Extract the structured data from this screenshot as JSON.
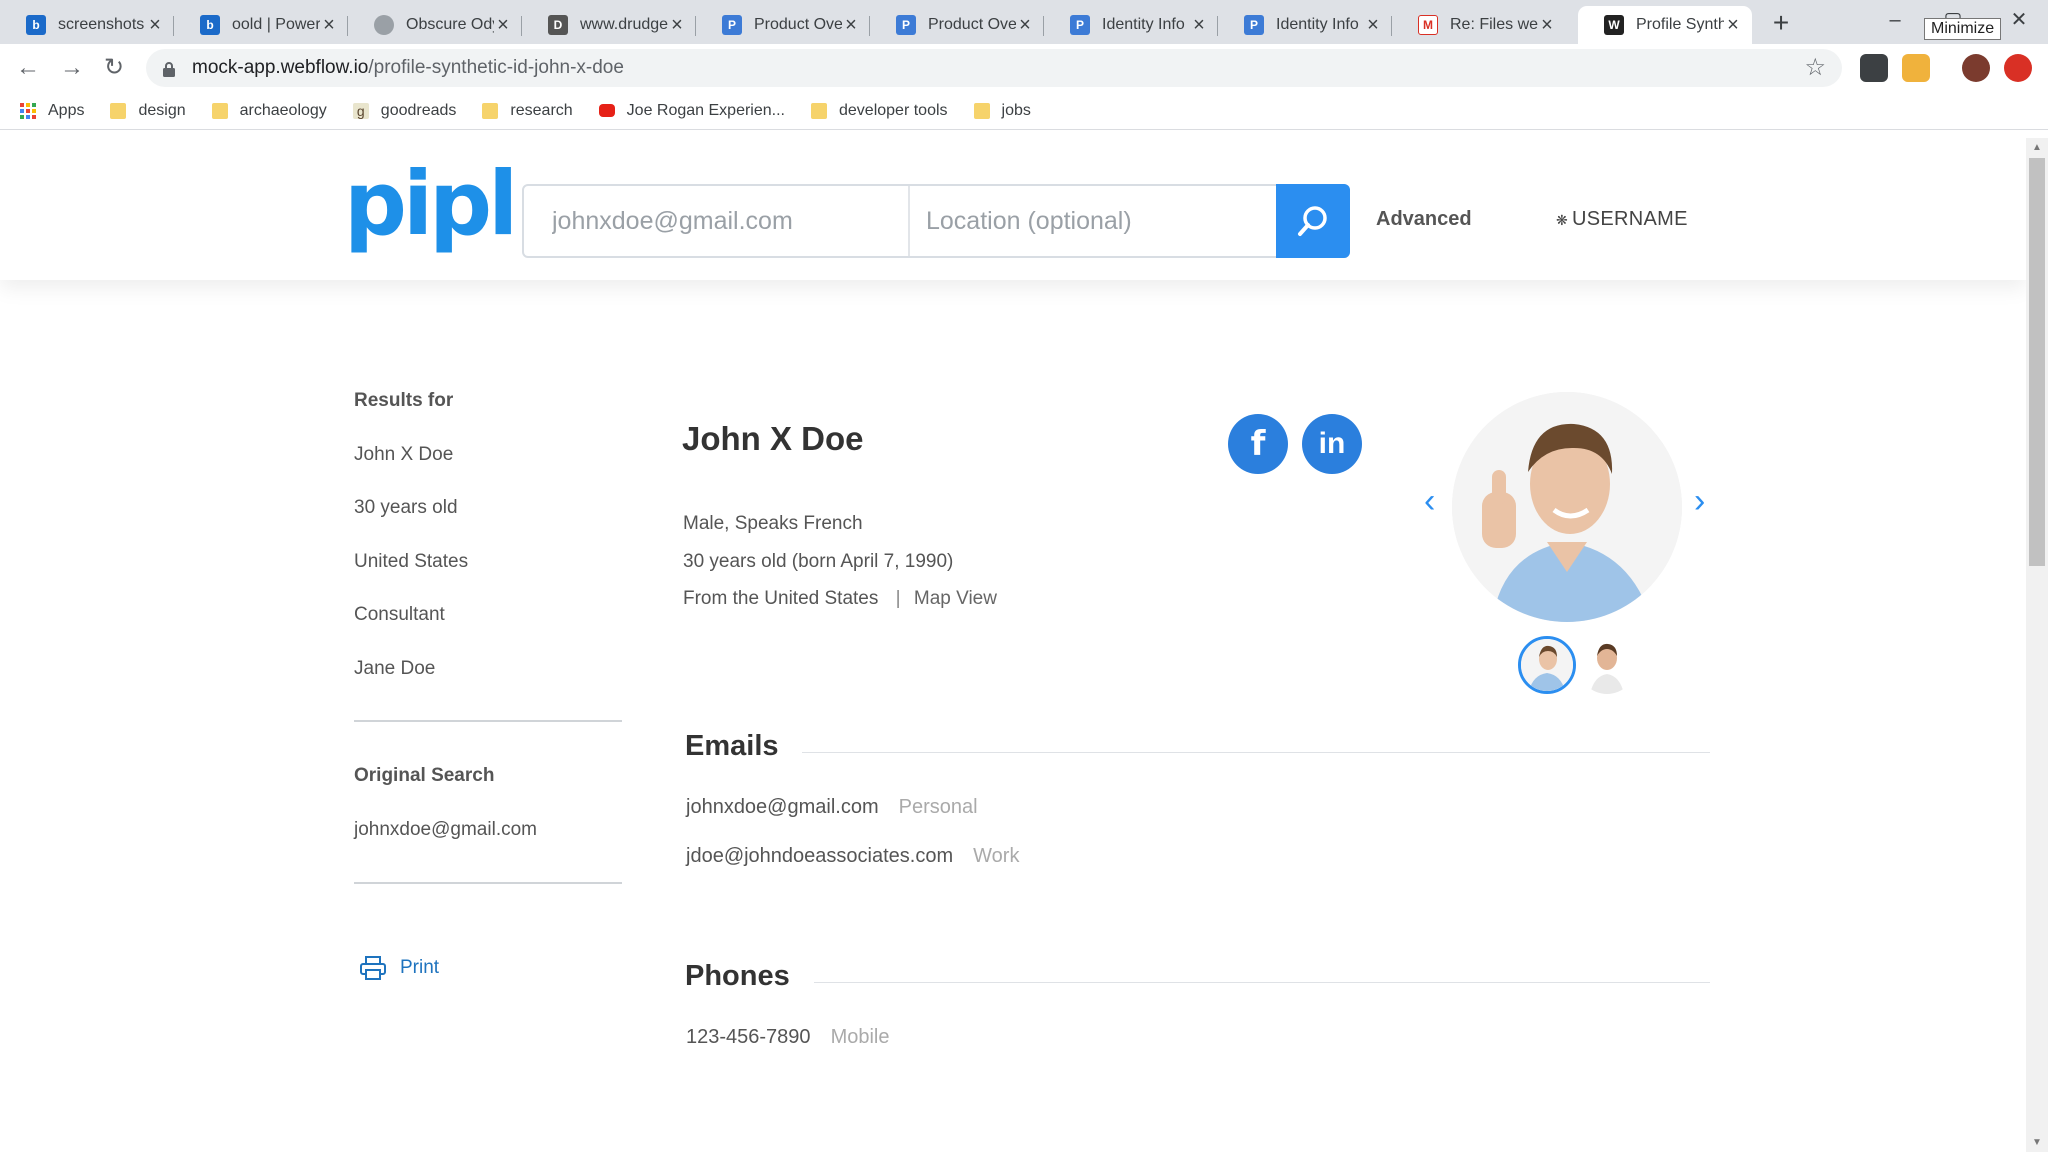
{
  "browser": {
    "tabs": [
      {
        "title": "screenshots",
        "favicon": "box",
        "color": "#1b6ac9"
      },
      {
        "title": "oold | Power",
        "favicon": "box",
        "color": "#1b6ac9"
      },
      {
        "title": "Obscure Ody",
        "favicon": "web",
        "color": "#9aa0a6"
      },
      {
        "title": "www.drudge",
        "favicon": "dr",
        "color": "#555555"
      },
      {
        "title": "Product Ove",
        "favicon": "P",
        "color": "#3d7bd6"
      },
      {
        "title": "Product Ove",
        "favicon": "P",
        "color": "#3d7bd6"
      },
      {
        "title": "Identity Info",
        "favicon": "P",
        "color": "#3d7bd6"
      },
      {
        "title": "Identity Info",
        "favicon": "P",
        "color": "#3d7bd6"
      },
      {
        "title": "Re: Files we",
        "favicon": "M",
        "color": "#d93025"
      },
      {
        "title": "Profile Synth",
        "favicon": "W",
        "color": "#222222"
      }
    ],
    "tooltip": "Minimize",
    "url": "mock-app.webflow.io/profile-synthetic-id-john-x-doe",
    "url_domain": "mock-app.webflow.io",
    "url_path": "/profile-synthetic-id-john-x-doe",
    "bookmarks": [
      {
        "label": "Apps",
        "icon": "apps-grid-icon"
      },
      {
        "label": "design",
        "icon": "folder-icon"
      },
      {
        "label": "archaeology",
        "icon": "folder-icon"
      },
      {
        "label": "goodreads",
        "icon": "goodreads-icon"
      },
      {
        "label": "research",
        "icon": "folder-icon"
      },
      {
        "label": "Joe Rogan Experien...",
        "icon": "youtube-icon"
      },
      {
        "label": "developer tools",
        "icon": "folder-icon"
      },
      {
        "label": "jobs",
        "icon": "folder-icon"
      }
    ]
  },
  "header": {
    "logo": "pipl",
    "search_placeholder": "johnxdoe@gmail.com",
    "location_placeholder": "Location (optional)",
    "advanced": "Advanced",
    "username": "USERNAME",
    "accent": "#2b8ef0"
  },
  "sidebar": {
    "results_label": "Results for",
    "results": [
      "John X Doe",
      "30 years old",
      "United States",
      "Consultant",
      "Jane Doe"
    ],
    "original_search_label": "Original Search",
    "original_search": "johnxdoe@gmail.com",
    "print": "Print"
  },
  "profile": {
    "name": "John X Doe",
    "gender_lang": "Male, Speaks French",
    "age": "30 years old (born April 7, 1990)",
    "origin": "From the United States",
    "map_sep": "|",
    "map_view": "Map View",
    "social": [
      {
        "label": "f",
        "icon": "facebook-icon"
      },
      {
        "label": "in",
        "icon": "linkedin-icon"
      }
    ]
  },
  "emails": {
    "title": "Emails",
    "items": [
      {
        "value": "johnxdoe@gmail.com",
        "type": "Personal"
      },
      {
        "value": "jdoe@johndoeassociates.com",
        "type": "Work"
      }
    ]
  },
  "phones": {
    "title": "Phones",
    "items": [
      {
        "value": "123-456-7890",
        "type": "Mobile"
      }
    ]
  }
}
